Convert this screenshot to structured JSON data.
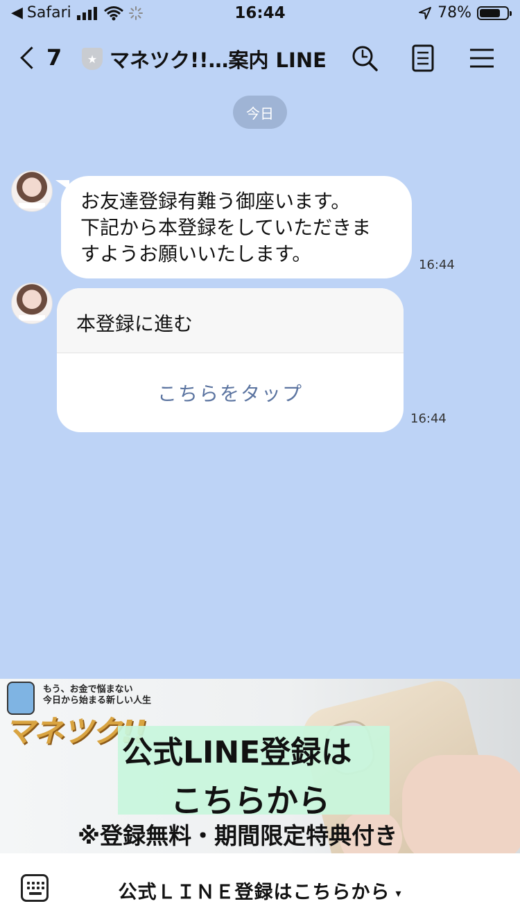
{
  "status_bar": {
    "back_app": "Safari",
    "time": "16:44",
    "battery": "78%",
    "battery_level": 0.78
  },
  "header": {
    "back_count": "7",
    "title": "マネツク!!…案内 LINE"
  },
  "chat": {
    "date_label": "今日",
    "messages": [
      {
        "lines": [
          "お友達登録有難う御座います。",
          "下記から本登録をしていただきま",
          "すようお願いいたします。"
        ],
        "time": "16:44"
      }
    ],
    "card": {
      "title": "本登録に進む",
      "action": "こちらをタップ",
      "time": "16:44"
    }
  },
  "banner": {
    "tagline_1": "もう、お金で悩まない",
    "tagline_2": "今日から始まる新しい人生",
    "logo": "マネツク!!",
    "cta_line1": "公式LINE登録は",
    "cta_line2": "こちらから",
    "note": "※登録無料・期間限定特典付き"
  },
  "bottom_bar": {
    "menu_label": "公式ＬＩＮＥ登録はこちらから",
    "menu_caret": "▾"
  }
}
